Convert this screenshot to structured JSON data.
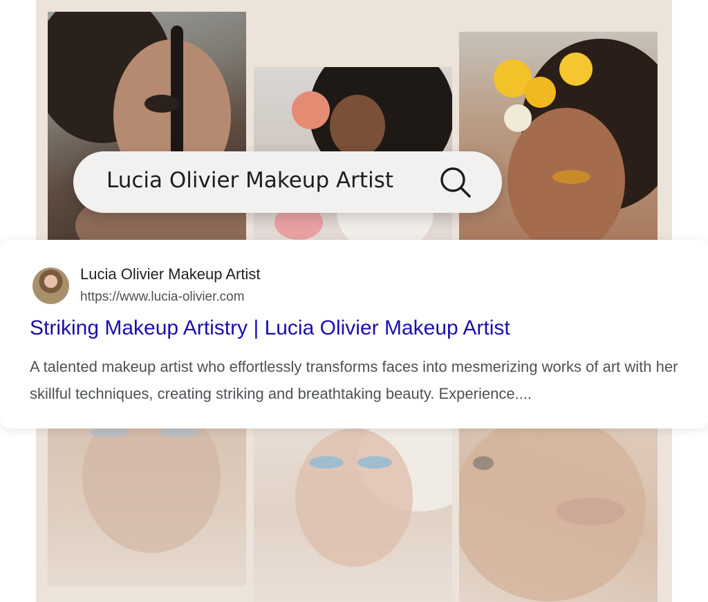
{
  "search": {
    "query": "Lucia Olivier Makeup Artist"
  },
  "result": {
    "site_name": "Lucia Olivier Makeup Artist",
    "url": "https://www.lucia-olivier.com",
    "title": "Striking Makeup Artistry | Lucia Olivier Makeup Artist",
    "snippet": "A talented makeup artist who effortlessly transforms faces into mesmerizing works of art with her skillful techniques, creating striking and breathtaking beauty. Experience...."
  },
  "icons": {
    "search": "search-icon",
    "favicon": "site-favicon"
  },
  "colors": {
    "link": "#1a0dab",
    "backdrop": "#ece3da",
    "pill": "#f3f1ef"
  }
}
